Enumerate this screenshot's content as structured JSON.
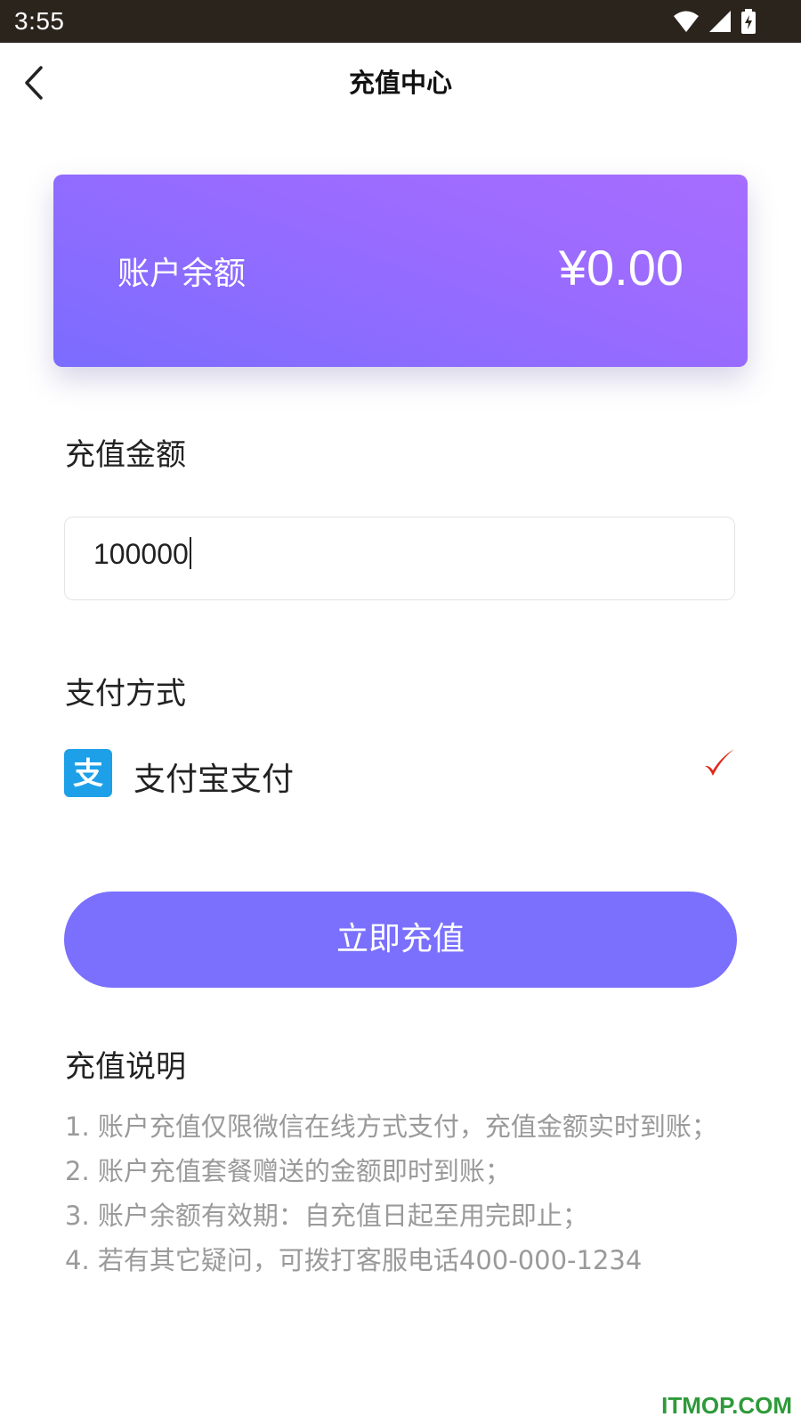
{
  "status_bar": {
    "time": "3:55",
    "icons": [
      "wifi-icon",
      "signal-icon",
      "battery-charging-icon"
    ]
  },
  "header": {
    "title": "充值中心",
    "back_icon": "chevron-left-icon"
  },
  "balance": {
    "label": "账户余额",
    "value": "¥0.00"
  },
  "recharge": {
    "section_title": "充值金额",
    "amount_value": "100000"
  },
  "payment": {
    "section_title": "支付方式",
    "selected_method": {
      "label": "支付宝支付",
      "logo_char": "支",
      "icon": "alipay-icon",
      "checked": true
    }
  },
  "submit_button": {
    "label": "立即充值"
  },
  "notes": {
    "title": "充值说明",
    "items": [
      "1.  账户充值仅限微信在线方式支付，充值金额实时到账；",
      "2.  账户充值套餐赠送的金额即时到账；",
      "3.  账户余额有效期：自充值日起至用完即止；",
      "4.  若有其它疑问，可拨打客服电话400-000-1234"
    ]
  },
  "watermark": "ITMOP.COM",
  "colors": {
    "accent": "#7a70fd",
    "card_gradient_start": "#7b6cff",
    "card_gradient_end": "#a66dff",
    "alipay_blue": "#1ea0e8",
    "check_red": "#e0281c",
    "status_bar": "#2b241d"
  }
}
